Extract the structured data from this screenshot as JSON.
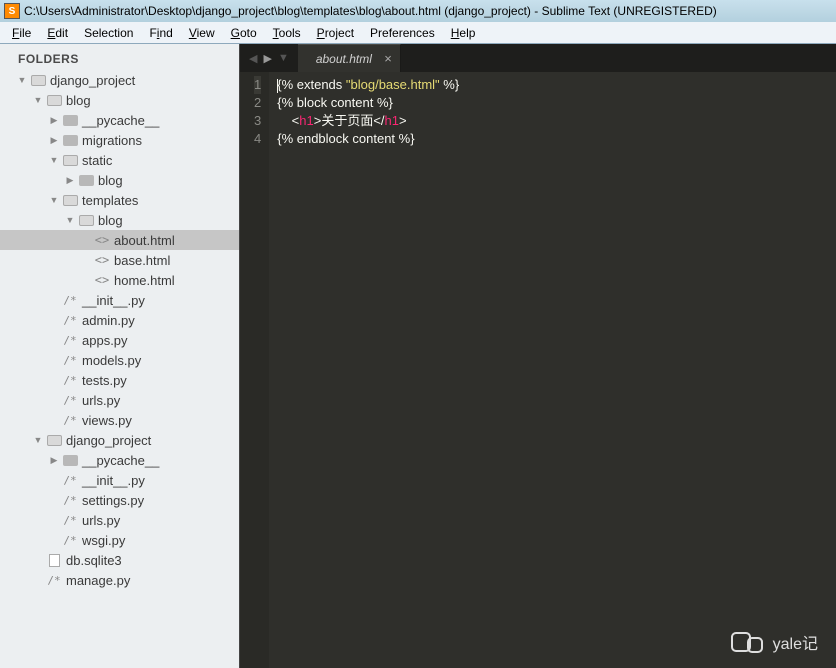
{
  "window": {
    "title": "C:\\Users\\Administrator\\Desktop\\django_project\\blog\\templates\\blog\\about.html (django_project) - Sublime Text (UNREGISTERED)"
  },
  "menu": {
    "items": [
      "File",
      "Edit",
      "Selection",
      "Find",
      "View",
      "Goto",
      "Tools",
      "Project",
      "Preferences",
      "Help"
    ]
  },
  "sidebar": {
    "header": "FOLDERS",
    "tree": [
      {
        "depth": 1,
        "arrow": "open",
        "icon": "folder-open",
        "label": "django_project"
      },
      {
        "depth": 2,
        "arrow": "open",
        "icon": "folder-open",
        "label": "blog"
      },
      {
        "depth": 3,
        "arrow": "closed",
        "icon": "folder",
        "label": "__pycache__"
      },
      {
        "depth": 3,
        "arrow": "closed",
        "icon": "folder",
        "label": "migrations"
      },
      {
        "depth": 3,
        "arrow": "open",
        "icon": "folder-open",
        "label": "static"
      },
      {
        "depth": 4,
        "arrow": "closed",
        "icon": "folder",
        "label": "blog"
      },
      {
        "depth": 3,
        "arrow": "open",
        "icon": "folder-open",
        "label": "templates"
      },
      {
        "depth": 4,
        "arrow": "open",
        "icon": "folder-open",
        "label": "blog"
      },
      {
        "depth": 5,
        "arrow": "none",
        "icon": "html",
        "label": "about.html",
        "selected": true
      },
      {
        "depth": 5,
        "arrow": "none",
        "icon": "html",
        "label": "base.html"
      },
      {
        "depth": 5,
        "arrow": "none",
        "icon": "html",
        "label": "home.html"
      },
      {
        "depth": 3,
        "arrow": "none",
        "icon": "code",
        "label": "__init__.py"
      },
      {
        "depth": 3,
        "arrow": "none",
        "icon": "code",
        "label": "admin.py"
      },
      {
        "depth": 3,
        "arrow": "none",
        "icon": "code",
        "label": "apps.py"
      },
      {
        "depth": 3,
        "arrow": "none",
        "icon": "code",
        "label": "models.py"
      },
      {
        "depth": 3,
        "arrow": "none",
        "icon": "code",
        "label": "tests.py"
      },
      {
        "depth": 3,
        "arrow": "none",
        "icon": "code",
        "label": "urls.py"
      },
      {
        "depth": 3,
        "arrow": "none",
        "icon": "code",
        "label": "views.py"
      },
      {
        "depth": 2,
        "arrow": "open",
        "icon": "folder-open",
        "label": "django_project"
      },
      {
        "depth": 3,
        "arrow": "closed",
        "icon": "folder",
        "label": "__pycache__"
      },
      {
        "depth": 3,
        "arrow": "none",
        "icon": "code",
        "label": "__init__.py"
      },
      {
        "depth": 3,
        "arrow": "none",
        "icon": "code",
        "label": "settings.py"
      },
      {
        "depth": 3,
        "arrow": "none",
        "icon": "code",
        "label": "urls.py"
      },
      {
        "depth": 3,
        "arrow": "none",
        "icon": "code",
        "label": "wsgi.py"
      },
      {
        "depth": 2,
        "arrow": "none",
        "icon": "plain",
        "label": "db.sqlite3"
      },
      {
        "depth": 2,
        "arrow": "none",
        "icon": "code",
        "label": "manage.py"
      }
    ]
  },
  "editor": {
    "tab_name": "about.html",
    "line_numbers": [
      "1",
      "2",
      "3",
      "4"
    ],
    "code_lines": {
      "l1a": "{% extends ",
      "l1b": "\"blog/base.html\"",
      "l1c": " %}",
      "l2": "{% block content %}",
      "l3a": "    <",
      "l3b": "h1",
      "l3c": ">关于页面</",
      "l3d": "h1",
      "l3e": ">",
      "l4": "{% endblock content %}"
    }
  },
  "watermark": {
    "text": "yale记"
  }
}
